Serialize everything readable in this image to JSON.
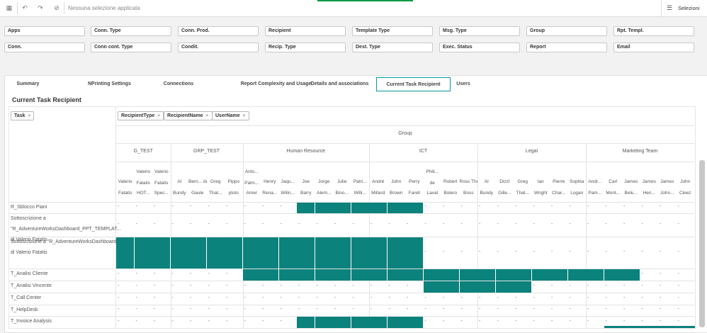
{
  "toolbar": {
    "selection_text": "Nessuna selezione applicata",
    "selections_label": "Selezioni"
  },
  "filters": [
    "Apps",
    "Conn. Type",
    "Conn. Prod.",
    "Recipient",
    "Template Type",
    "Msg. Type",
    "Group",
    "Rpt. Templ.",
    "Conn.",
    "Conn cont. Type",
    "Condit.",
    "Recip. Type",
    "Dest. Type",
    "Exec. Status",
    "Report",
    "Email"
  ],
  "tabs": [
    {
      "label": "Summary",
      "active": false
    },
    {
      "label": "NPrinting Settings",
      "active": false
    },
    {
      "label": "Connections",
      "active": false
    },
    {
      "label": "Report Complexity and Usage",
      "active": false
    },
    {
      "label": "Details and associations",
      "active": false
    },
    {
      "label": "Current Task Recipient",
      "active": true
    },
    {
      "label": "Users",
      "active": false
    }
  ],
  "section_title": "Current Task Recipient",
  "dimension_buttons": {
    "task": "Task",
    "recipient_type": "RecipientType",
    "recipient_name": "RecipientName",
    "user_name": "UserName"
  },
  "group_header": "Group",
  "groups": [
    {
      "name": "G_TEST",
      "columns": [
        [
          "Valerio",
          "Fatatis"
        ],
        [
          "Valerio Fatatis",
          "HOT..."
        ],
        [
          "Valerio Fatatis",
          "Spec..."
        ]
      ]
    },
    {
      "name": "GRP_TEST",
      "columns": [
        [
          "Al",
          "Bundy"
        ],
        [
          "Bern... de",
          "Gaule"
        ],
        [
          "Greg",
          "That..."
        ],
        [
          "Pippo",
          "pluto"
        ]
      ]
    },
    {
      "name": "Human Resource",
      "columns": [
        [
          "Anto... Palm...",
          "Amer"
        ],
        [
          "Henry",
          "Rena..."
        ],
        [
          "Jaqu...",
          "Wilin..."
        ],
        [
          "Joe",
          "Barry"
        ],
        [
          "Jorge",
          "Alem..."
        ],
        [
          "Julie",
          "Bino..."
        ],
        [
          "Patri...",
          "Willi..."
        ]
      ]
    },
    {
      "name": "ICT",
      "columns": [
        [
          "André",
          "Millard"
        ],
        [
          "John",
          "Brown"
        ],
        [
          "Perry",
          "Farell"
        ],
        [
          "Phili... de",
          "Laval"
        ],
        [
          "Robert",
          "Bolero"
        ],
        [
          "Ross The",
          "Boss"
        ]
      ]
    },
    {
      "name": "Legal",
      "columns": [
        [
          "Al",
          "Bundy"
        ],
        [
          "Dizzi",
          "Gille..."
        ],
        [
          "Greg",
          "That..."
        ],
        [
          "Ian",
          "Wright"
        ],
        [
          "Pierre",
          "Char..."
        ],
        [
          "Sophia",
          "Logan"
        ]
      ]
    },
    {
      "name": "Marketing Team",
      "columns": [
        [
          "Andr...",
          "Pam..."
        ],
        [
          "Carl",
          "Mont..."
        ],
        [
          "James",
          "Belu..."
        ],
        [
          "James",
          "Hen..."
        ],
        [
          "James",
          "John..."
        ],
        [
          "John",
          "Cleez"
        ]
      ]
    }
  ],
  "rows": [
    {
      "lines": [
        "R_Sblocco Piani"
      ],
      "filled": [
        10,
        11,
        12,
        13,
        14,
        15,
        16
      ]
    },
    {
      "lines": [
        "Sottoscrizione a",
        "\"R_AdventureWorksDashboard_PPT_TEMPLAT...",
        "di Valerio Fatatis"
      ],
      "filled": []
    },
    {
      "lines": [
        "Sottoscrizione a \"R_AdventureWorksDashboard\"",
        "di Valerio Fatatis"
      ],
      "filled": [
        0,
        1,
        2,
        3,
        4,
        5,
        6,
        7,
        8,
        9,
        10,
        11,
        12,
        13,
        14,
        15,
        16
      ]
    },
    {
      "lines": [
        "T_Analisi Cliente"
      ],
      "filled": [
        7,
        8,
        9,
        10,
        11,
        12,
        13,
        14,
        15,
        16,
        17,
        18,
        19,
        20,
        21,
        22,
        23,
        24,
        25,
        26,
        27,
        28
      ]
    },
    {
      "lines": [
        "T_Analisi Vincente"
      ],
      "filled": [
        17,
        18,
        19,
        20,
        21,
        22
      ]
    },
    {
      "lines": [
        "T_Call Center"
      ],
      "filled": []
    },
    {
      "lines": [
        "T_HelpDesk"
      ],
      "filled": []
    },
    {
      "lines": [
        "T_Invoice Analysis"
      ],
      "filled": [
        10,
        11,
        12,
        13,
        14,
        15,
        16
      ]
    }
  ],
  "empty_cell": "-",
  "colors": {
    "accent": "#009845",
    "tab_border": "#009aa3",
    "filled_cell": "#0b827c"
  }
}
